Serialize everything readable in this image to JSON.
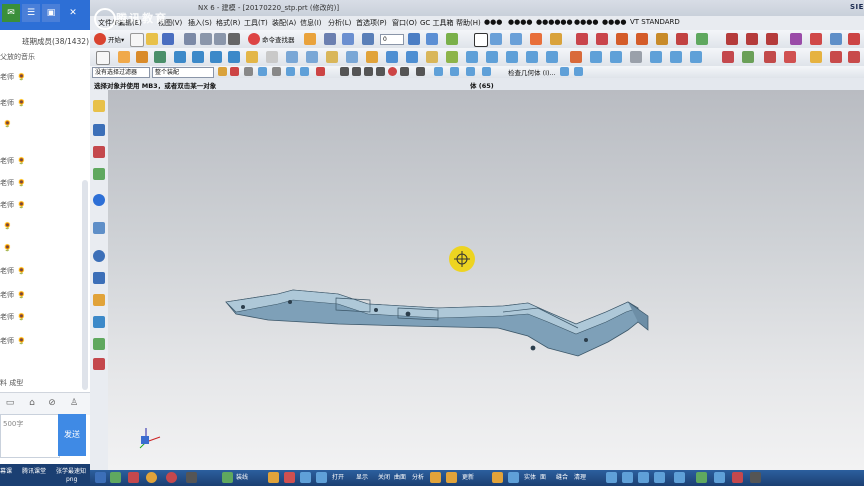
{
  "chat": {
    "members": "班期成员(38/1432)",
    "music": "父放的音乐",
    "messages": [
      {
        "text": "老师",
        "dot": "🌻"
      },
      {
        "text": "老师",
        "dot": "🌻"
      },
      {
        "text": "",
        "dot": "🌻"
      },
      {
        "text": "老师",
        "dot": "🌻"
      },
      {
        "text": "老师",
        "dot": "🌻"
      },
      {
        "text": "老师",
        "dot": "🌻"
      },
      {
        "text": "",
        "dot": "🌻"
      },
      {
        "text": "",
        "dot": "🌻"
      },
      {
        "text": "老师",
        "dot": "🌻"
      },
      {
        "text": "老师",
        "dot": "🌻"
      },
      {
        "text": "老师",
        "dot": "🌻"
      },
      {
        "text": "老师",
        "dot": "🌻"
      },
      {
        "text": "料 成型",
        "dot": ""
      }
    ],
    "input_placeholder": "500字",
    "send": "发送"
  },
  "window": {
    "title": "NX 6 - 建模 - [20170220_stp.prt (修改的)]",
    "brand": "SIEMENS",
    "watermark": "腾讯教育"
  },
  "menubar": [
    "文件(F)",
    "编辑(E)",
    "视图(V)",
    "插入(S)",
    "格式(R)",
    "工具(T)",
    "装配(A)",
    "信息(I)",
    "分析(L)",
    "首选项(P)",
    "窗口(O)",
    "GC 工具箱",
    "帮助(H)",
    "●●●",
    "●●●●",
    "●●●●●●",
    "●●●●",
    "●●●●",
    "VT STANDARD"
  ],
  "toolbar": {
    "start": "开始▾",
    "command_finder": "命令查找器",
    "layer": "0",
    "filter": "没有选择过滤器",
    "assembly": "整个装配",
    "check_geometry": "检查几何体 (I)..."
  },
  "prompt": {
    "left": "选择对象并使用 MB3，或者双击某一对象",
    "right": "体 (65)"
  },
  "bottom": {
    "labels": [
      "装线",
      "打开",
      "显示",
      "关闭",
      "曲面",
      "分析",
      "更新",
      "实体",
      "面",
      "缝合",
      "清理"
    ]
  },
  "taskbar": [
    "幕课",
    "腾讯课堂",
    "张学最速知",
    "png"
  ],
  "colors": {
    "accent_blue": "#2d6fd6",
    "part_color": "#7ea0b8",
    "wcs_yellow": "#f2d400"
  }
}
